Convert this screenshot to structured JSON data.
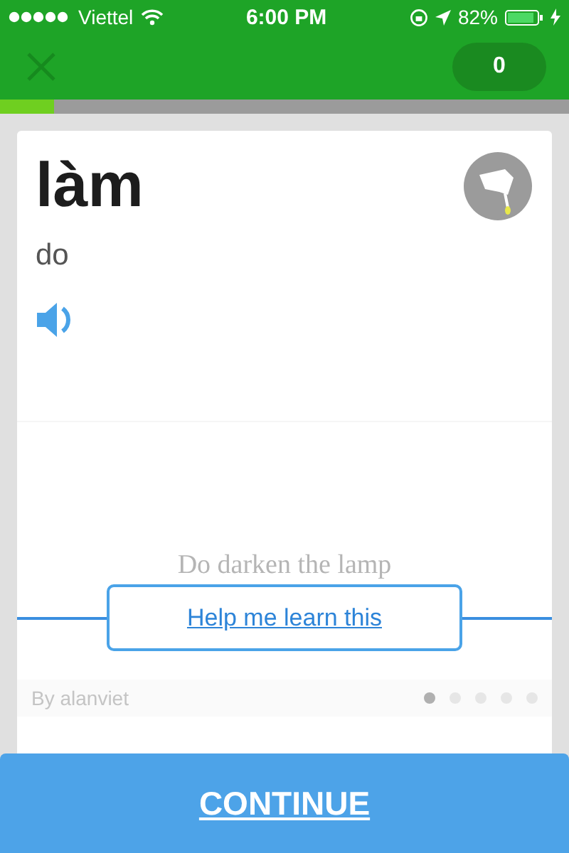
{
  "status_bar": {
    "carrier": "Viettel",
    "time": "6:00 PM",
    "battery": "82%"
  },
  "header": {
    "score": "0"
  },
  "progress": {
    "level": 0.095
  },
  "card": {
    "word": "làm",
    "meaning": "do",
    "mem": {
      "text": "Do darken the lamp",
      "author": "By alanviet",
      "dots": [
        {
          "selected": true
        },
        {
          "selected": false
        },
        {
          "selected": false
        },
        {
          "selected": false
        },
        {
          "selected": false
        }
      ]
    },
    "help_button": "Help me learn this"
  },
  "continue_button": "CONTINUE"
}
